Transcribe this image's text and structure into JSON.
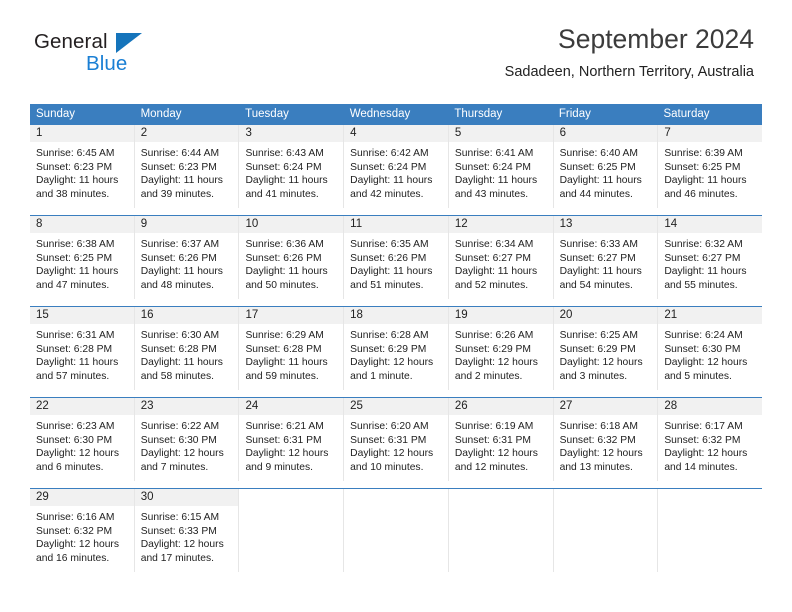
{
  "brand": {
    "name_top": "General",
    "name_bottom": "Blue",
    "triangle_color": "#1574bb",
    "blue_text_color": "#1a7fd4"
  },
  "header": {
    "title": "September 2024",
    "subtitle": "Sadadeen, Northern Territory, Australia"
  },
  "theme": {
    "header_blue": "#3a7ebf",
    "daynum_bg": "#f1f1f1",
    "cell_border": "#e6e6e6",
    "text": "#222222"
  },
  "weekdays": [
    "Sunday",
    "Monday",
    "Tuesday",
    "Wednesday",
    "Thursday",
    "Friday",
    "Saturday"
  ],
  "labels": {
    "sunrise_prefix": "Sunrise:",
    "sunset_prefix": "Sunset:",
    "daylight_prefix": "Daylight:"
  },
  "weeks": [
    [
      {
        "day": "1",
        "sunrise": "Sunrise: 6:45 AM",
        "sunset": "Sunset: 6:23 PM",
        "daylight_line1": "Daylight: 11 hours",
        "daylight_line2": "and 38 minutes."
      },
      {
        "day": "2",
        "sunrise": "Sunrise: 6:44 AM",
        "sunset": "Sunset: 6:23 PM",
        "daylight_line1": "Daylight: 11 hours",
        "daylight_line2": "and 39 minutes."
      },
      {
        "day": "3",
        "sunrise": "Sunrise: 6:43 AM",
        "sunset": "Sunset: 6:24 PM",
        "daylight_line1": "Daylight: 11 hours",
        "daylight_line2": "and 41 minutes."
      },
      {
        "day": "4",
        "sunrise": "Sunrise: 6:42 AM",
        "sunset": "Sunset: 6:24 PM",
        "daylight_line1": "Daylight: 11 hours",
        "daylight_line2": "and 42 minutes."
      },
      {
        "day": "5",
        "sunrise": "Sunrise: 6:41 AM",
        "sunset": "Sunset: 6:24 PM",
        "daylight_line1": "Daylight: 11 hours",
        "daylight_line2": "and 43 minutes."
      },
      {
        "day": "6",
        "sunrise": "Sunrise: 6:40 AM",
        "sunset": "Sunset: 6:25 PM",
        "daylight_line1": "Daylight: 11 hours",
        "daylight_line2": "and 44 minutes."
      },
      {
        "day": "7",
        "sunrise": "Sunrise: 6:39 AM",
        "sunset": "Sunset: 6:25 PM",
        "daylight_line1": "Daylight: 11 hours",
        "daylight_line2": "and 46 minutes."
      }
    ],
    [
      {
        "day": "8",
        "sunrise": "Sunrise: 6:38 AM",
        "sunset": "Sunset: 6:25 PM",
        "daylight_line1": "Daylight: 11 hours",
        "daylight_line2": "and 47 minutes."
      },
      {
        "day": "9",
        "sunrise": "Sunrise: 6:37 AM",
        "sunset": "Sunset: 6:26 PM",
        "daylight_line1": "Daylight: 11 hours",
        "daylight_line2": "and 48 minutes."
      },
      {
        "day": "10",
        "sunrise": "Sunrise: 6:36 AM",
        "sunset": "Sunset: 6:26 PM",
        "daylight_line1": "Daylight: 11 hours",
        "daylight_line2": "and 50 minutes."
      },
      {
        "day": "11",
        "sunrise": "Sunrise: 6:35 AM",
        "sunset": "Sunset: 6:26 PM",
        "daylight_line1": "Daylight: 11 hours",
        "daylight_line2": "and 51 minutes."
      },
      {
        "day": "12",
        "sunrise": "Sunrise: 6:34 AM",
        "sunset": "Sunset: 6:27 PM",
        "daylight_line1": "Daylight: 11 hours",
        "daylight_line2": "and 52 minutes."
      },
      {
        "day": "13",
        "sunrise": "Sunrise: 6:33 AM",
        "sunset": "Sunset: 6:27 PM",
        "daylight_line1": "Daylight: 11 hours",
        "daylight_line2": "and 54 minutes."
      },
      {
        "day": "14",
        "sunrise": "Sunrise: 6:32 AM",
        "sunset": "Sunset: 6:27 PM",
        "daylight_line1": "Daylight: 11 hours",
        "daylight_line2": "and 55 minutes."
      }
    ],
    [
      {
        "day": "15",
        "sunrise": "Sunrise: 6:31 AM",
        "sunset": "Sunset: 6:28 PM",
        "daylight_line1": "Daylight: 11 hours",
        "daylight_line2": "and 57 minutes."
      },
      {
        "day": "16",
        "sunrise": "Sunrise: 6:30 AM",
        "sunset": "Sunset: 6:28 PM",
        "daylight_line1": "Daylight: 11 hours",
        "daylight_line2": "and 58 minutes."
      },
      {
        "day": "17",
        "sunrise": "Sunrise: 6:29 AM",
        "sunset": "Sunset: 6:28 PM",
        "daylight_line1": "Daylight: 11 hours",
        "daylight_line2": "and 59 minutes."
      },
      {
        "day": "18",
        "sunrise": "Sunrise: 6:28 AM",
        "sunset": "Sunset: 6:29 PM",
        "daylight_line1": "Daylight: 12 hours",
        "daylight_line2": "and 1 minute."
      },
      {
        "day": "19",
        "sunrise": "Sunrise: 6:26 AM",
        "sunset": "Sunset: 6:29 PM",
        "daylight_line1": "Daylight: 12 hours",
        "daylight_line2": "and 2 minutes."
      },
      {
        "day": "20",
        "sunrise": "Sunrise: 6:25 AM",
        "sunset": "Sunset: 6:29 PM",
        "daylight_line1": "Daylight: 12 hours",
        "daylight_line2": "and 3 minutes."
      },
      {
        "day": "21",
        "sunrise": "Sunrise: 6:24 AM",
        "sunset": "Sunset: 6:30 PM",
        "daylight_line1": "Daylight: 12 hours",
        "daylight_line2": "and 5 minutes."
      }
    ],
    [
      {
        "day": "22",
        "sunrise": "Sunrise: 6:23 AM",
        "sunset": "Sunset: 6:30 PM",
        "daylight_line1": "Daylight: 12 hours",
        "daylight_line2": "and 6 minutes."
      },
      {
        "day": "23",
        "sunrise": "Sunrise: 6:22 AM",
        "sunset": "Sunset: 6:30 PM",
        "daylight_line1": "Daylight: 12 hours",
        "daylight_line2": "and 7 minutes."
      },
      {
        "day": "24",
        "sunrise": "Sunrise: 6:21 AM",
        "sunset": "Sunset: 6:31 PM",
        "daylight_line1": "Daylight: 12 hours",
        "daylight_line2": "and 9 minutes."
      },
      {
        "day": "25",
        "sunrise": "Sunrise: 6:20 AM",
        "sunset": "Sunset: 6:31 PM",
        "daylight_line1": "Daylight: 12 hours",
        "daylight_line2": "and 10 minutes."
      },
      {
        "day": "26",
        "sunrise": "Sunrise: 6:19 AM",
        "sunset": "Sunset: 6:31 PM",
        "daylight_line1": "Daylight: 12 hours",
        "daylight_line2": "and 12 minutes."
      },
      {
        "day": "27",
        "sunrise": "Sunrise: 6:18 AM",
        "sunset": "Sunset: 6:32 PM",
        "daylight_line1": "Daylight: 12 hours",
        "daylight_line2": "and 13 minutes."
      },
      {
        "day": "28",
        "sunrise": "Sunrise: 6:17 AM",
        "sunset": "Sunset: 6:32 PM",
        "daylight_line1": "Daylight: 12 hours",
        "daylight_line2": "and 14 minutes."
      }
    ],
    [
      {
        "day": "29",
        "sunrise": "Sunrise: 6:16 AM",
        "sunset": "Sunset: 6:32 PM",
        "daylight_line1": "Daylight: 12 hours",
        "daylight_line2": "and 16 minutes."
      },
      {
        "day": "30",
        "sunrise": "Sunrise: 6:15 AM",
        "sunset": "Sunset: 6:33 PM",
        "daylight_line1": "Daylight: 12 hours",
        "daylight_line2": "and 17 minutes."
      },
      {
        "day": "",
        "sunrise": "",
        "sunset": "",
        "daylight_line1": "",
        "daylight_line2": ""
      },
      {
        "day": "",
        "sunrise": "",
        "sunset": "",
        "daylight_line1": "",
        "daylight_line2": ""
      },
      {
        "day": "",
        "sunrise": "",
        "sunset": "",
        "daylight_line1": "",
        "daylight_line2": ""
      },
      {
        "day": "",
        "sunrise": "",
        "sunset": "",
        "daylight_line1": "",
        "daylight_line2": ""
      },
      {
        "day": "",
        "sunrise": "",
        "sunset": "",
        "daylight_line1": "",
        "daylight_line2": ""
      }
    ]
  ]
}
